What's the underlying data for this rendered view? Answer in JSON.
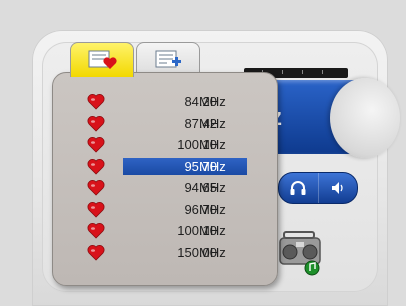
{
  "tabs": [
    {
      "name": "favorites",
      "icon": "favorite-list-icon",
      "active": true
    },
    {
      "name": "add",
      "icon": "add-to-list-icon",
      "active": false
    }
  ],
  "favorites": [
    {
      "freq": "84.20",
      "unit": "MHz",
      "selected": false
    },
    {
      "freq": "87.42",
      "unit": "MHz",
      "selected": false
    },
    {
      "freq": "100.10",
      "unit": "MHz",
      "selected": false
    },
    {
      "freq": "95.70",
      "unit": "MHz",
      "selected": true
    },
    {
      "freq": "94.65",
      "unit": "MHz",
      "selected": false
    },
    {
      "freq": "96.70",
      "unit": "MHz",
      "selected": false
    },
    {
      "freq": "100.10",
      "unit": "MHz",
      "selected": false
    },
    {
      "freq": "150.00",
      "unit": "MHz",
      "selected": false
    }
  ],
  "tuner": {
    "visible_letter": "z"
  },
  "buttons": [
    {
      "icon": "headphones-icon"
    },
    {
      "icon": "speaker-icon"
    }
  ],
  "colors": {
    "accent_blue": "#1a4aa4",
    "heart_red": "#d8121a",
    "tab_yellow": "#f2d800",
    "popup_bg": "#c4bfbb"
  }
}
